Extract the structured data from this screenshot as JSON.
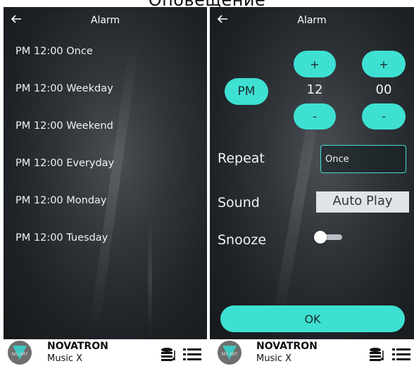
{
  "caption": "Оповещение",
  "left_screen": {
    "title": "Alarm",
    "alarms": [
      "PM 12:00 Once",
      "PM 12:00 Weekday",
      "PM 12:00 Weekend",
      "PM 12:00 Everyday",
      "PM 12:00 Monday",
      "PM 12:00 Tuesday"
    ]
  },
  "right_screen": {
    "title": "Alarm",
    "ampm": "PM",
    "hour": "12",
    "minute": "00",
    "plus": "+",
    "minus": "-",
    "repeat_label": "Repeat",
    "repeat_value": "Once",
    "sound_label": "Sound",
    "sound_value": "Auto Play",
    "snooze_label": "Snooze",
    "snooze_on": false,
    "ok_label": "OK"
  },
  "footer": {
    "brand_title": "NOVATRON",
    "brand_subtitle": "Music X",
    "logo_text": "NO ART"
  },
  "colors": {
    "accent": "#3ee0d2",
    "background": "#1e2226"
  },
  "icons": [
    "back-arrow-icon",
    "music-library-icon",
    "list-menu-icon"
  ]
}
